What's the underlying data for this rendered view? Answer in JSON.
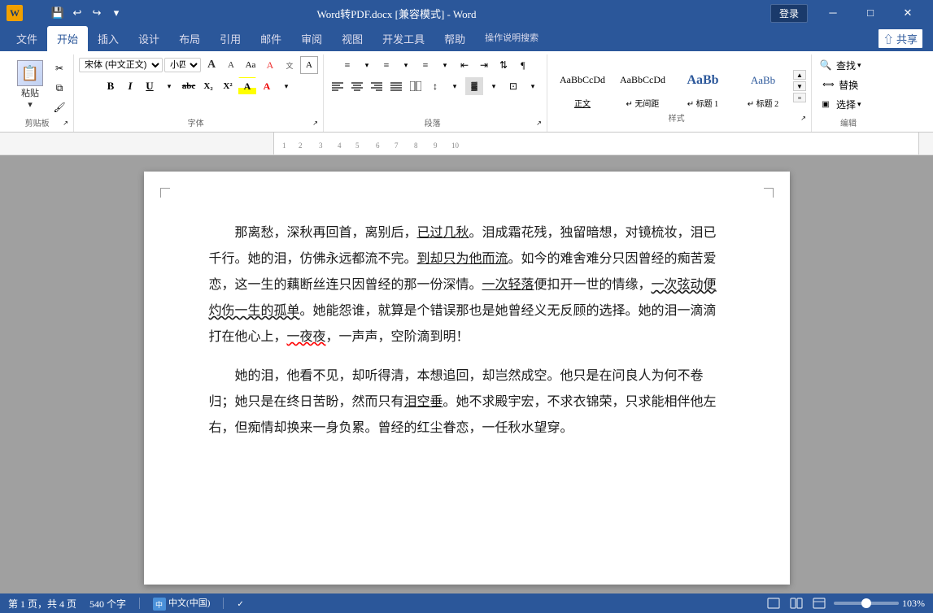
{
  "titlebar": {
    "title": "Word转PDF.docx [兼容模式] - Word",
    "login_label": "登录",
    "icon_text": "W"
  },
  "quickaccess": {
    "save_title": "保存",
    "undo_title": "撤销",
    "redo_title": "重做",
    "more_title": "更多"
  },
  "tabs": [
    {
      "label": "文件",
      "active": false
    },
    {
      "label": "开始",
      "active": true
    },
    {
      "label": "插入",
      "active": false
    },
    {
      "label": "设计",
      "active": false
    },
    {
      "label": "布局",
      "active": false
    },
    {
      "label": "引用",
      "active": false
    },
    {
      "label": "邮件",
      "active": false
    },
    {
      "label": "审阅",
      "active": false
    },
    {
      "label": "视图",
      "active": false
    },
    {
      "label": "开发工具",
      "active": false
    },
    {
      "label": "帮助",
      "active": false
    },
    {
      "label": "操作说明搜索",
      "active": false
    }
  ],
  "ribbon": {
    "clipboard": {
      "label": "剪贴板",
      "paste": "粘贴",
      "cut": "✂",
      "copy": "⧉",
      "painter": "🖌"
    },
    "font": {
      "label": "字体",
      "name": "宋体 (中文正文)",
      "size": "小四",
      "grow": "A",
      "shrink": "A",
      "case": "Aa",
      "clear": "A",
      "color_a": "文",
      "bold": "B",
      "italic": "I",
      "underline": "U",
      "strikethrough": "abc",
      "sub": "X₂",
      "sup": "X²",
      "highlight": "A",
      "fontcolor": "A"
    },
    "paragraph": {
      "label": "段落",
      "bullet": "≡",
      "numbering": "≡",
      "multilevel": "≡",
      "decrease_indent": "⇤",
      "increase_indent": "⇥",
      "sort": "⇅",
      "show_marks": "¶",
      "align_left": "≡",
      "align_center": "≡",
      "align_right": "≡",
      "justify": "≡",
      "columns": "≡",
      "line_spacing": "↕",
      "shading": "▓",
      "borders": "⊡"
    },
    "styles": {
      "label": "样式",
      "items": [
        {
          "name": "正文",
          "preview": "正文",
          "active": true
        },
        {
          "name": "无间距",
          "preview": "无间距",
          "active": false
        },
        {
          "name": "标题 1",
          "preview": "AaBb",
          "active": false,
          "bold": true
        },
        {
          "name": "标题 2",
          "preview": "AaBb",
          "active": false
        }
      ]
    },
    "editing": {
      "label": "编辑",
      "find": "查找",
      "replace": "替换",
      "select": "选择"
    }
  },
  "content": {
    "para1": "那离愁，深秋再回首，离别后，已过几秋。泪成霜花残，独留暗想，对镜梳妆，泪已千行。她的泪，仿佛永远都流不完。到却只为他而流。如今的难舍难分只因曾经的痴苦爱恋，这一生的藕断丝连只因曾经的那一份深情。一次轻落便扣开一世的情缘，一次弦动便灼伤一生的孤单。她能怨谁，就算是个错误那也是她曾经义无反顾的选择。她的泪一滴滴打在他心上，一夜夜，一声声，空阶滴到明！",
    "para2": "她的泪，他看不见，却听得清，本想追回，却岂然成空。他只是在问良人为何不卷归；她只是在终日苦盼，然而只有泪空垂。她不求殿宇宏，不求衣锦荣，只求能相伴他左右，但痴情却换来一身负累。曾经的红尘眷恋，一任秋水望穿。",
    "underlined_segments": [
      "已过几秋",
      "到却只为他而流",
      "一次轻落",
      "一次弦动便灼伤一生的孤单",
      "一夜夜",
      "泪空垂"
    ]
  },
  "statusbar": {
    "pages": "第 1 页，共 4 页",
    "words": "540 个字",
    "lang_indicator": "中文(中国)",
    "zoom": "103%"
  }
}
